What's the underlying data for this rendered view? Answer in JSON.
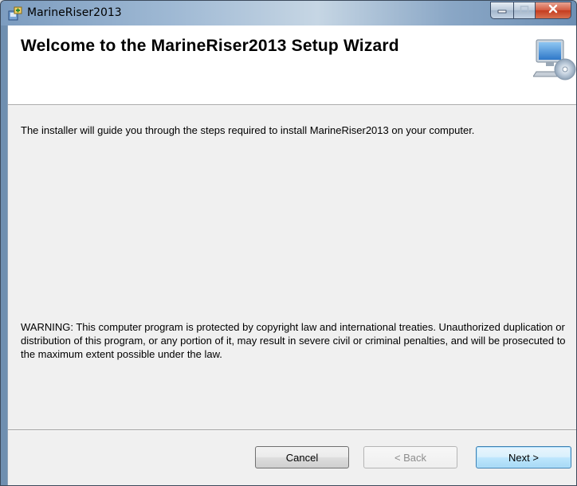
{
  "window": {
    "title": "MarineRiser2013"
  },
  "header": {
    "title": "Welcome to the MarineRiser2013 Setup Wizard"
  },
  "body": {
    "intro": "The installer will guide you through the steps required to install MarineRiser2013 on your computer.",
    "warning": "WARNING: This computer program is protected by copyright law and international treaties. Unauthorized duplication or distribution of this program, or any portion of it, may result in severe civil or criminal penalties, and will be prosecuted to the maximum extent possible under the law."
  },
  "buttons": {
    "cancel": "Cancel",
    "back": "< Back",
    "next": "Next >"
  },
  "icons": {
    "app": "installer-icon",
    "header": "computer-cd-icon",
    "minimize": "minimize-icon",
    "maximize": "maximize-icon",
    "close": "close-icon"
  },
  "colors": {
    "close_button": "#c53c1f",
    "next_button_border": "#3c7fb1"
  }
}
